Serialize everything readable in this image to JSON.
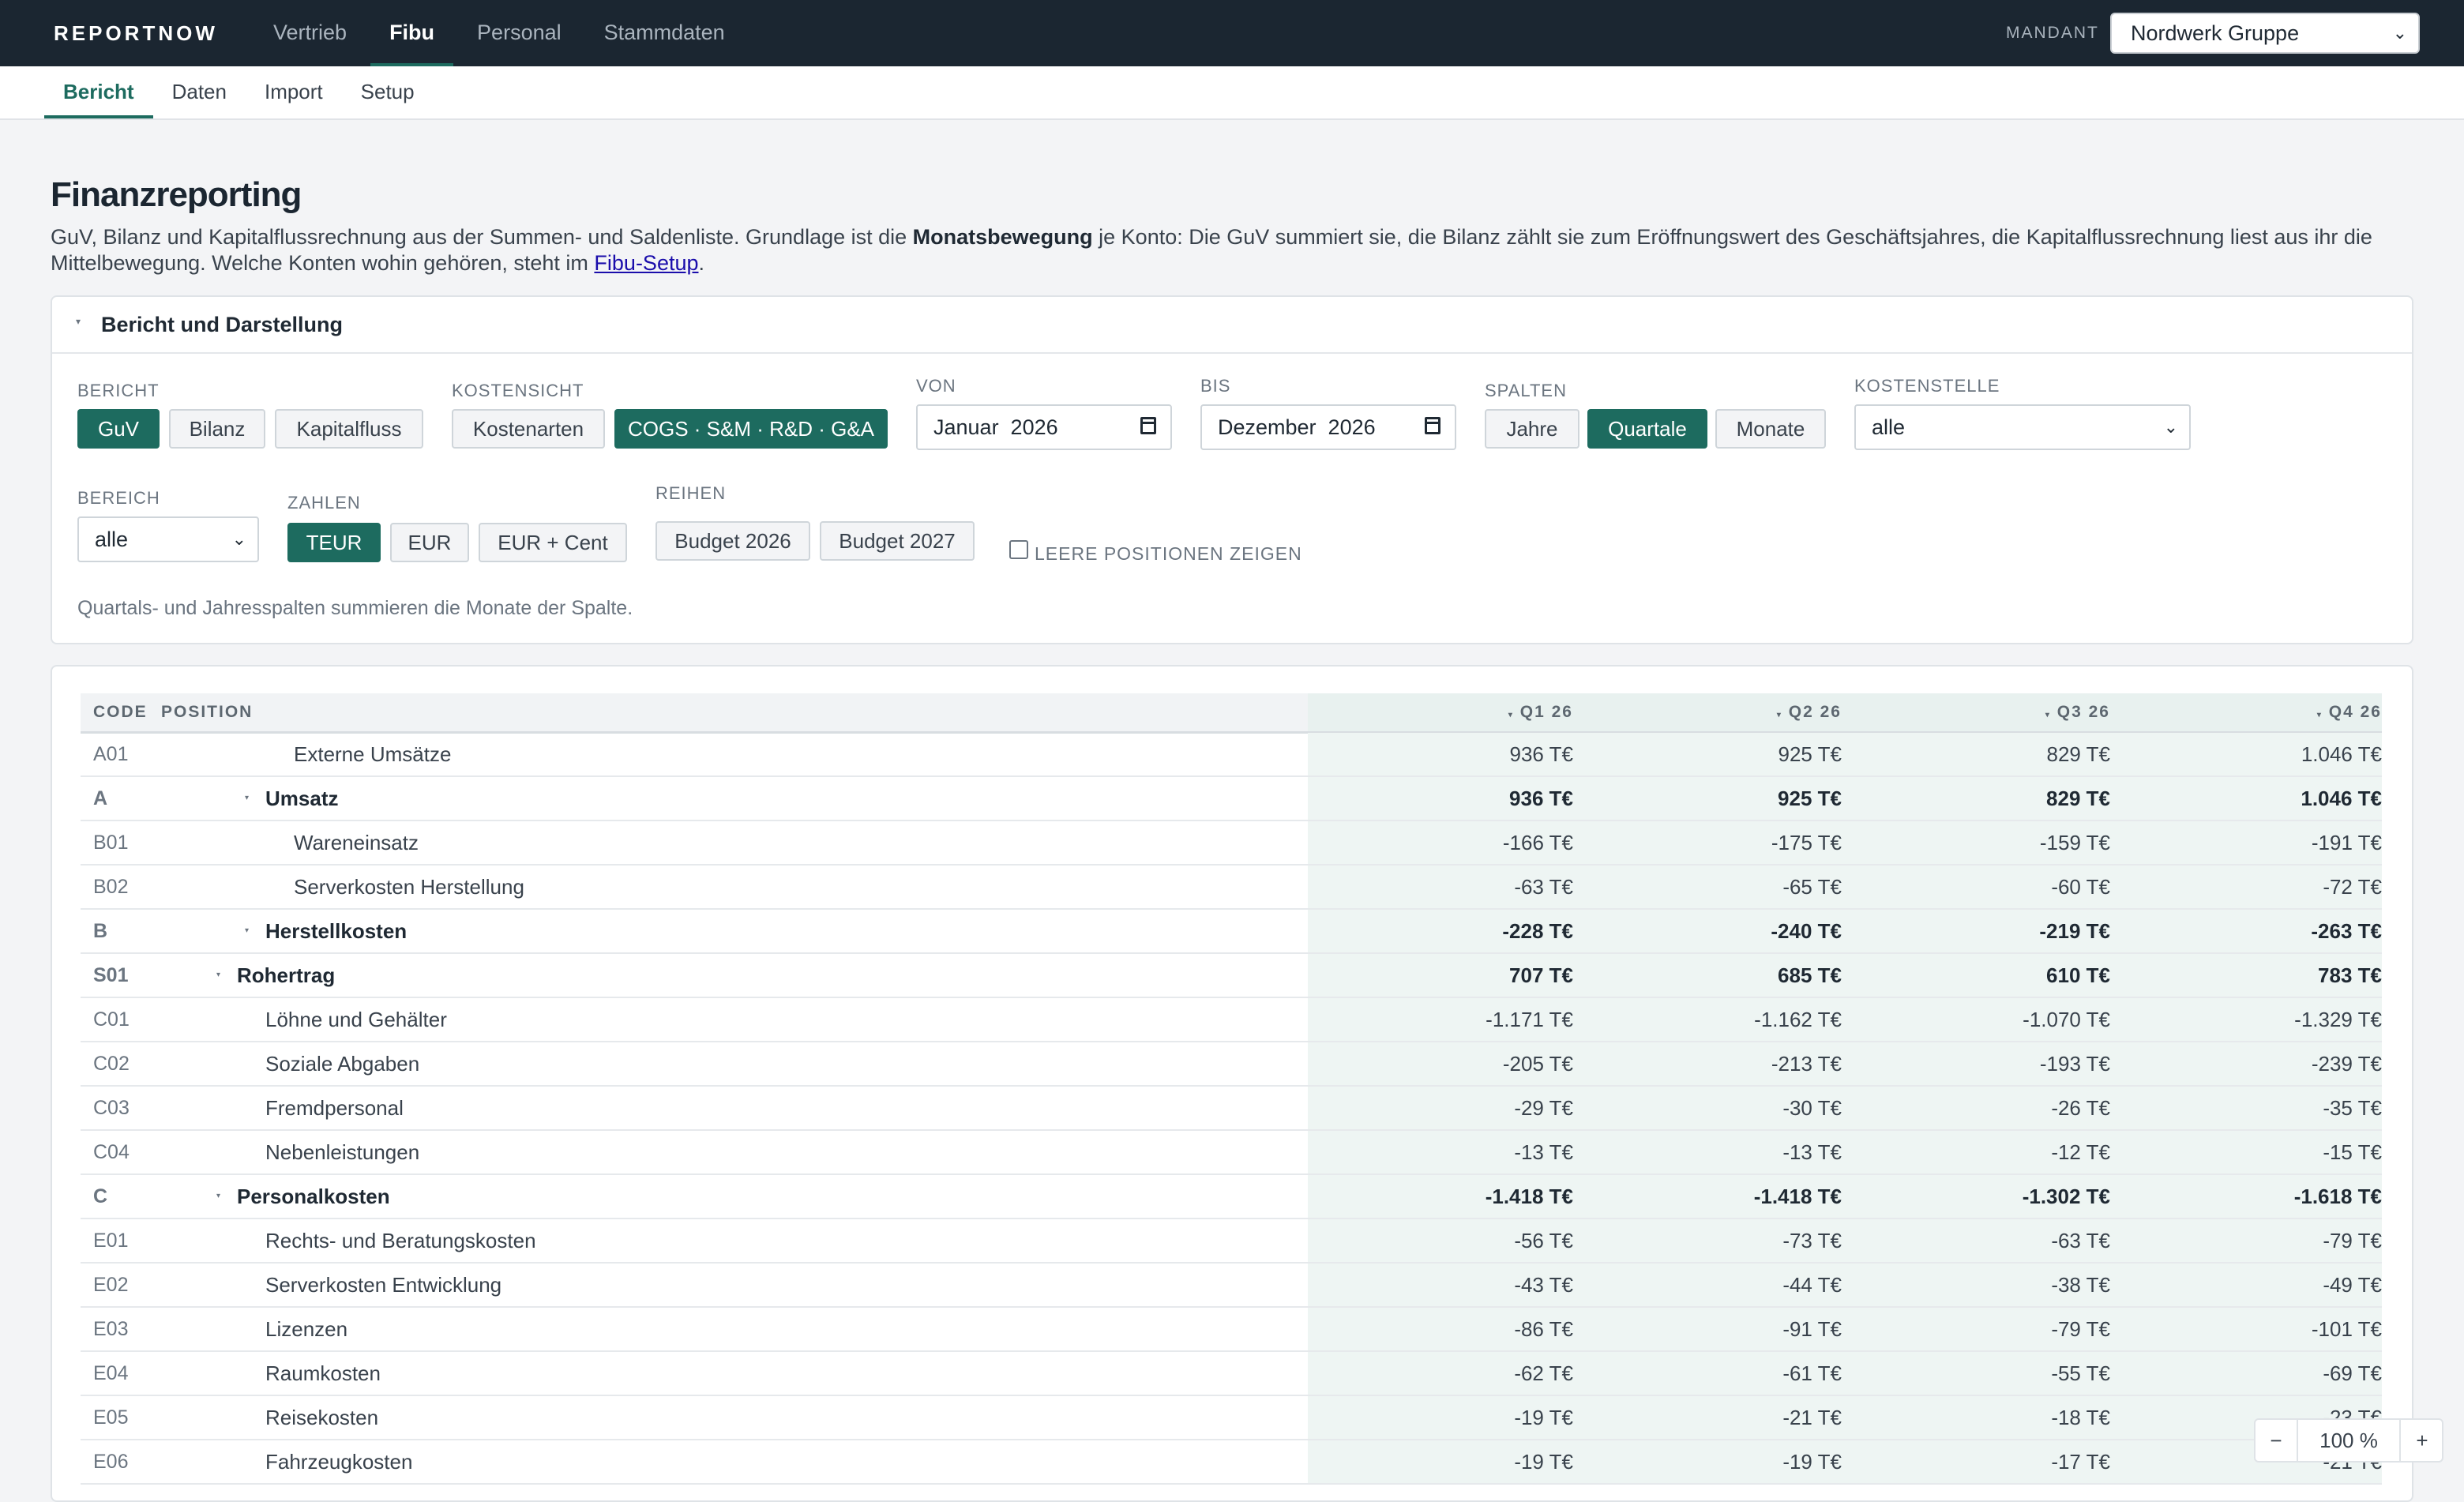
{
  "brand": "REPORTNOW",
  "topnav": [
    {
      "label": "Vertrieb"
    },
    {
      "label": "Fibu"
    },
    {
      "label": "Personal"
    },
    {
      "label": "Stammdaten"
    }
  ],
  "mandant": {
    "label": "MANDANT",
    "value": "Nordwerk Gruppe"
  },
  "subnav": [
    {
      "label": "Bericht"
    },
    {
      "label": "Daten"
    },
    {
      "label": "Import"
    },
    {
      "label": "Setup"
    }
  ],
  "page": {
    "title": "Finanzreporting",
    "intro_1": "GuV, Bilanz und Kapitalflussrechnung aus der Summen- und Saldenliste. Grundlage ist die ",
    "intro_bold": "Monatsbewegung",
    "intro_2": " je Konto: Die GuV summiert sie, die Bilanz zählt sie zum Eröffnungswert des Geschäftsjahres, die Kapitalflussrechnung liest aus ihr die Mittelbewegung. Welche Konten wohin gehören, steht im ",
    "intro_link": "Fibu-Setup",
    "intro_end": "."
  },
  "panel": {
    "title": "Bericht und Darstellung",
    "bericht": {
      "label": "BERICHT",
      "options": [
        "GuV",
        "Bilanz",
        "Kapitalfluss"
      ],
      "selected": "GuV"
    },
    "kostensicht": {
      "label": "KOSTENSICHT",
      "options": [
        "Kostenarten",
        "COGS · S&M · R&D · G&A"
      ],
      "selected": "COGS · S&M · R&D · G&A"
    },
    "von": {
      "label": "VON",
      "value": "Januar  2026"
    },
    "bis": {
      "label": "BIS",
      "value": "Dezember  2026"
    },
    "spalten": {
      "label": "SPALTEN",
      "options": [
        "Jahre",
        "Quartale",
        "Monate"
      ],
      "selected": "Quartale"
    },
    "kostenstelle": {
      "label": "KOSTENSTELLE",
      "value": "alle"
    },
    "bereich": {
      "label": "BEREICH",
      "value": "alle"
    },
    "zahlen": {
      "label": "ZAHLEN",
      "options": [
        "TEUR",
        "EUR",
        "EUR + Cent"
      ],
      "selected": "TEUR"
    },
    "reihen": {
      "label": "REIHEN",
      "options": [
        "Budget 2026",
        "Budget 2027"
      ]
    },
    "leere": {
      "label": "LEERE POSITIONEN ZEIGEN",
      "checked": false
    },
    "hint": "Quartals- und Jahresspalten summieren die Monate der Spalte."
  },
  "table": {
    "columns": {
      "code": "CODE",
      "position": "POSITION",
      "q1": "Q1 26",
      "q2": "Q2 26",
      "q3": "Q3 26",
      "q4": "Q4 26"
    },
    "rows": [
      {
        "code": "A01",
        "position": "Externe Umsätze",
        "level": 2,
        "bold": false,
        "q1": "936 T€",
        "q2": "925 T€",
        "q3": "829 T€",
        "q4": "1.046 T€"
      },
      {
        "code": "A",
        "position": "Umsatz",
        "level": 1,
        "bold": true,
        "q1": "936 T€",
        "q2": "925 T€",
        "q3": "829 T€",
        "q4": "1.046 T€"
      },
      {
        "code": "B01",
        "position": "Wareneinsatz",
        "level": 2,
        "bold": false,
        "q1": "-166 T€",
        "q2": "-175 T€",
        "q3": "-159 T€",
        "q4": "-191 T€"
      },
      {
        "code": "B02",
        "position": "Serverkosten Herstellung",
        "level": 2,
        "bold": false,
        "q1": "-63 T€",
        "q2": "-65 T€",
        "q3": "-60 T€",
        "q4": "-72 T€"
      },
      {
        "code": "B",
        "position": "Herstellkosten",
        "level": 1,
        "bold": true,
        "q1": "-228 T€",
        "q2": "-240 T€",
        "q3": "-219 T€",
        "q4": "-263 T€"
      },
      {
        "code": "S01",
        "position": "Rohertrag",
        "level": 0,
        "bold": true,
        "q1": "707 T€",
        "q2": "685 T€",
        "q3": "610 T€",
        "q4": "783 T€"
      },
      {
        "code": "C01",
        "position": "Löhne und Gehälter",
        "level": 1,
        "bold": false,
        "q1": "-1.171 T€",
        "q2": "-1.162 T€",
        "q3": "-1.070 T€",
        "q4": "-1.329 T€"
      },
      {
        "code": "C02",
        "position": "Soziale Abgaben",
        "level": 1,
        "bold": false,
        "q1": "-205 T€",
        "q2": "-213 T€",
        "q3": "-193 T€",
        "q4": "-239 T€"
      },
      {
        "code": "C03",
        "position": "Fremdpersonal",
        "level": 1,
        "bold": false,
        "q1": "-29 T€",
        "q2": "-30 T€",
        "q3": "-26 T€",
        "q4": "-35 T€"
      },
      {
        "code": "C04",
        "position": "Nebenleistungen",
        "level": 1,
        "bold": false,
        "q1": "-13 T€",
        "q2": "-13 T€",
        "q3": "-12 T€",
        "q4": "-15 T€"
      },
      {
        "code": "C",
        "position": "Personalkosten",
        "level": 0,
        "bold": true,
        "q1": "-1.418 T€",
        "q2": "-1.418 T€",
        "q3": "-1.302 T€",
        "q4": "-1.618 T€"
      },
      {
        "code": "E01",
        "position": "Rechts- und Beratungskosten",
        "level": 1,
        "bold": false,
        "q1": "-56 T€",
        "q2": "-73 T€",
        "q3": "-63 T€",
        "q4": "-79 T€"
      },
      {
        "code": "E02",
        "position": "Serverkosten Entwicklung",
        "level": 1,
        "bold": false,
        "q1": "-43 T€",
        "q2": "-44 T€",
        "q3": "-38 T€",
        "q4": "-49 T€"
      },
      {
        "code": "E03",
        "position": "Lizenzen",
        "level": 1,
        "bold": false,
        "q1": "-86 T€",
        "q2": "-91 T€",
        "q3": "-79 T€",
        "q4": "-101 T€"
      },
      {
        "code": "E04",
        "position": "Raumkosten",
        "level": 1,
        "bold": false,
        "q1": "-62 T€",
        "q2": "-61 T€",
        "q3": "-55 T€",
        "q4": "-69 T€"
      },
      {
        "code": "E05",
        "position": "Reisekosten",
        "level": 1,
        "bold": false,
        "q1": "-19 T€",
        "q2": "-21 T€",
        "q3": "-18 T€",
        "q4": "-23 T€"
      },
      {
        "code": "E06",
        "position": "Fahrzeugkosten",
        "level": 1,
        "bold": false,
        "q1": "-19 T€",
        "q2": "-19 T€",
        "q3": "-17 T€",
        "q4": "-21 T€"
      }
    ]
  },
  "zoom": {
    "minus": "−",
    "level": "100 %",
    "plus": "+"
  },
  "colors": {
    "accent": "#1d6b5f",
    "topbar": "#1b2631",
    "column_highlight": "#eef5f3"
  }
}
